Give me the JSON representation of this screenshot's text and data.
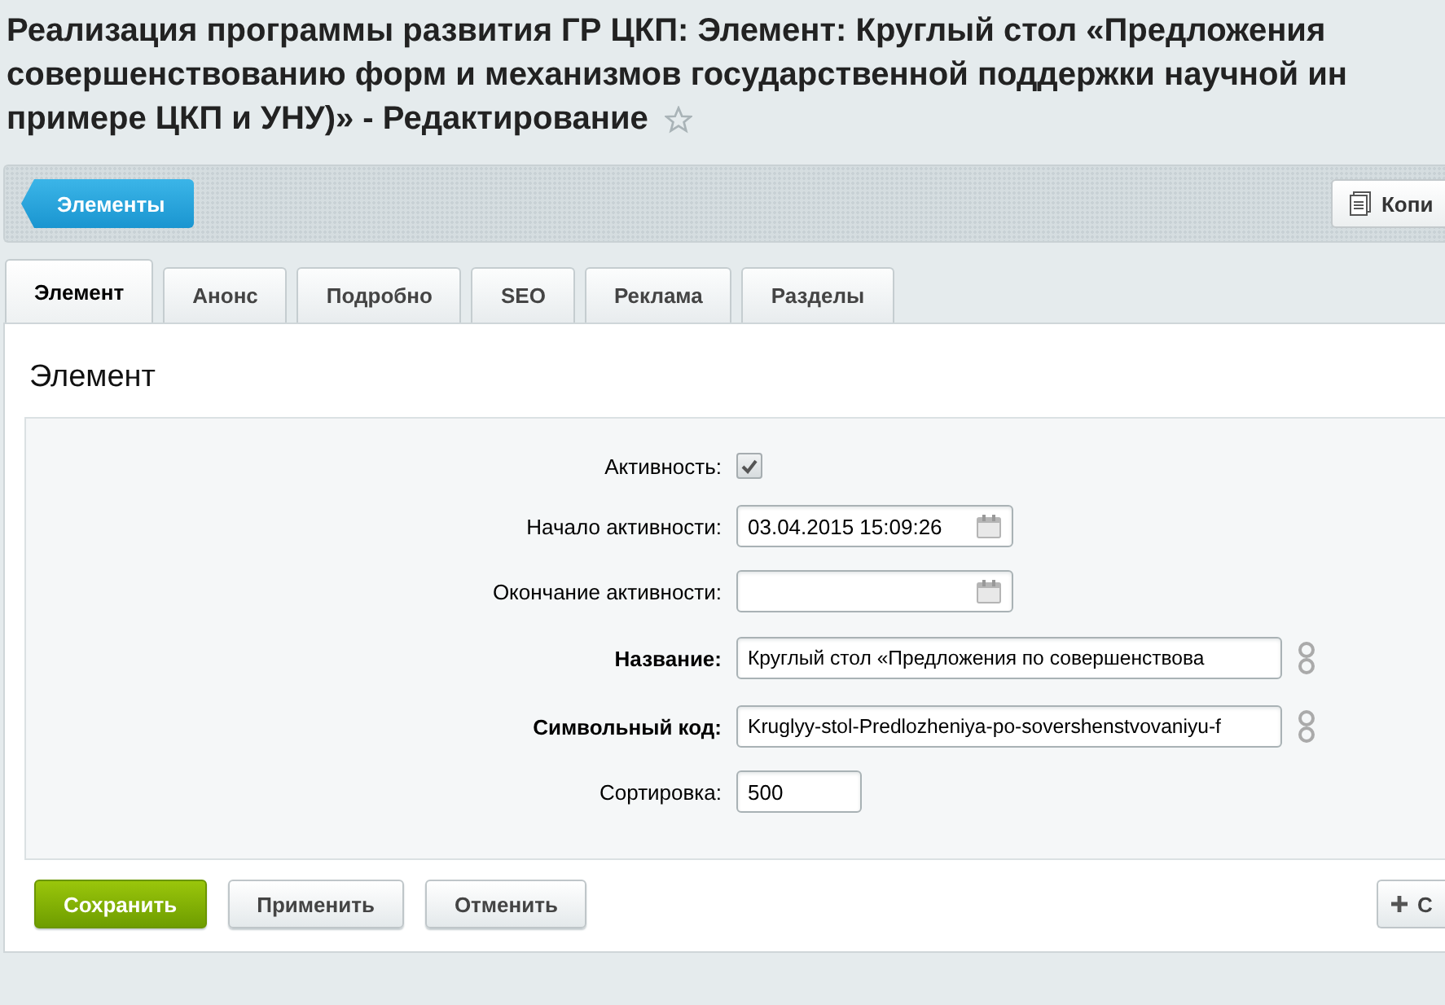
{
  "title_lines": [
    "Реализация программы развития ГР ЦКП: Элемент: Круглый стол «Предложения",
    "совершенствованию форм и механизмов государственной поддержки научной ин",
    "примере ЦКП и УНУ)» - Редактирование"
  ],
  "favorite": false,
  "toolbar": {
    "back_button": "Элементы",
    "copy_button": "Копи"
  },
  "tabs": [
    {
      "label": "Элемент",
      "selected": true
    },
    {
      "label": "Анонс",
      "selected": false
    },
    {
      "label": "Подробно",
      "selected": false
    },
    {
      "label": "SEO",
      "selected": false
    },
    {
      "label": "Реклама",
      "selected": false
    },
    {
      "label": "Разделы",
      "selected": false
    }
  ],
  "section_title": "Элемент",
  "fields": [
    {
      "kind": "checkbox",
      "label": "Активность:",
      "required": false,
      "checked": true
    },
    {
      "kind": "date",
      "label": "Начало активности:",
      "required": false,
      "value": "03.04.2015 15:09:26"
    },
    {
      "kind": "date",
      "label": "Окончание активности:",
      "required": false
    },
    {
      "kind": "linked",
      "label": "Название:",
      "required": true,
      "value": "Круглый стол «Предложения по совершенствова"
    },
    {
      "kind": "linked",
      "label": "Символьный код:",
      "required": true,
      "value": "Kruglyy-stol-Predlozheniya-po-sovershenstvovaniyu-f"
    },
    {
      "kind": "short",
      "label": "Сортировка:",
      "required": false,
      "value": "500"
    }
  ],
  "buttons": {
    "save": "Сохранить",
    "apply": "Применить",
    "cancel": "Отменить",
    "add": "С"
  }
}
